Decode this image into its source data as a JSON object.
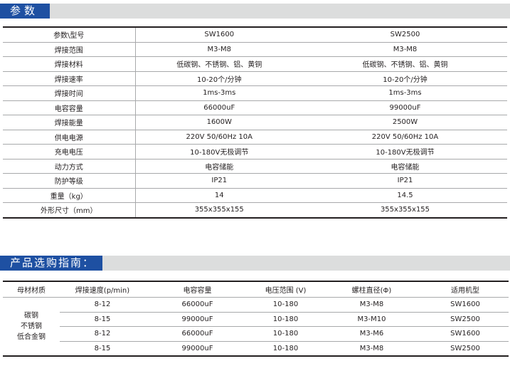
{
  "params_section": {
    "title": "参数",
    "header": {
      "label": "参数\\型号",
      "model1": "SW1600",
      "model2": "SW2500"
    },
    "rows": [
      {
        "label": "焊接范围",
        "v1": "M3-M8",
        "v2": "M3-M8"
      },
      {
        "label": "焊接材料",
        "v1": "低碳钢、不锈钢、铝、黄铜",
        "v2": "低碳钢、不锈钢、铝、黄铜"
      },
      {
        "label": "焊接速率",
        "v1": "10-20个/分钟",
        "v2": "10-20个/分钟"
      },
      {
        "label": "焊接时间",
        "v1": "1ms-3ms",
        "v2": "1ms-3ms"
      },
      {
        "label": "电容容量",
        "v1": "66000uF",
        "v2": "99000uF"
      },
      {
        "label": "焊接能量",
        "v1": "1600W",
        "v2": "2500W"
      },
      {
        "label": "供电电源",
        "v1": "220V  50/60Hz  10A",
        "v2": "220V  50/60Hz  10A"
      },
      {
        "label": "充电电压",
        "v1": "10-180V无极调节",
        "v2": "10-180V无极调节"
      },
      {
        "label": "动力方式",
        "v1": "电容储能",
        "v2": "电容储能"
      },
      {
        "label": "防护等级",
        "v1": "IP21",
        "v2": "IP21"
      },
      {
        "label": "重量（kg）",
        "v1": "14",
        "v2": "14.5"
      },
      {
        "label": "外形尺寸（mm）",
        "v1": "355x355x155",
        "v2": "355x355x155"
      }
    ]
  },
  "guide_section": {
    "title": "产品选购指南：",
    "headers": [
      "母材材质",
      "焊接速度(p/min)",
      "电容容量",
      "电压范围 (V)",
      "螺柱直径(Φ)",
      "适用机型"
    ],
    "materials": [
      "碳钢",
      "不锈钢",
      "低合金钢"
    ],
    "rows": [
      {
        "speed": "8-12",
        "capacity": "66000uF",
        "voltage": "10-180",
        "diameter": "M3-M8",
        "model": "SW1600"
      },
      {
        "speed": "8-15",
        "capacity": "99000uF",
        "voltage": "10-180",
        "diameter": "M3-M10",
        "model": "SW2500"
      },
      {
        "speed": "8-12",
        "capacity": "66000uF",
        "voltage": "10-180",
        "diameter": "M3-M6",
        "model": "SW1600"
      },
      {
        "speed": "8-15",
        "capacity": "99000uF",
        "voltage": "10-180",
        "diameter": "M3-M8",
        "model": "SW2500"
      }
    ]
  },
  "colors": {
    "accent": "#1e50a2",
    "bar_gray": "#dcdddd",
    "text": "#231f20",
    "rule": "#a8a9ab"
  }
}
